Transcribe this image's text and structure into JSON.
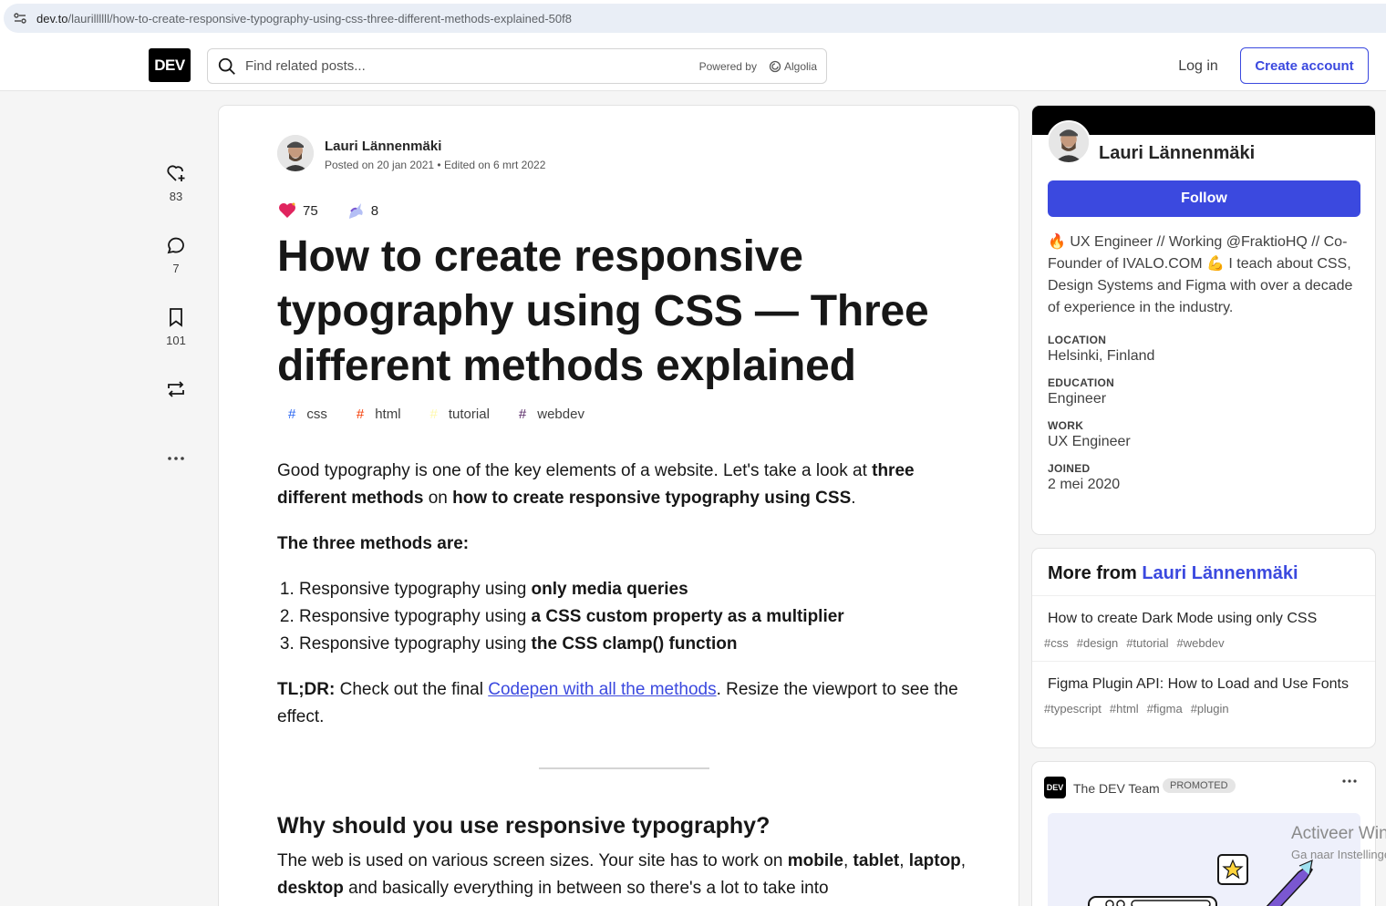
{
  "browser": {
    "url_host": "dev.to",
    "url_path": "/laurillllll/how-to-create-responsive-typography-using-css-three-different-methods-explained-50f8"
  },
  "header": {
    "logo": "DEV",
    "search_placeholder": "Find related posts...",
    "powered_by": "Powered by",
    "algolia": "Algolia",
    "login": "Log in",
    "create_account": "Create account"
  },
  "reactions_sidebar": {
    "likes": "83",
    "comments": "7",
    "bookmarks": "101"
  },
  "article": {
    "author": "Lauri Lännenmäki",
    "posted": "Posted on 20 jan 2021 • Edited on 6 mrt 2022",
    "heart_count": "75",
    "unicorn_count": "8",
    "title": "How to create responsive typography using CSS — Three different methods explained",
    "tags": [
      {
        "hash": "#",
        "name": "css",
        "color": "#2965f1"
      },
      {
        "hash": "#",
        "name": "html",
        "color": "#f53900"
      },
      {
        "hash": "#",
        "name": "tutorial",
        "color": "#fff9ac"
      },
      {
        "hash": "#",
        "name": "webdev",
        "color": "#562765"
      }
    ],
    "intro_1": "Good typography is one of the key elements of a website. Let's take a look at ",
    "intro_b1": "three different methods",
    "intro_2": " on ",
    "intro_b2": "how to create responsive typography using CSS",
    "intro_3": ".",
    "methods_heading": "The three methods are:",
    "methods": [
      {
        "pre": "Responsive typography using ",
        "bold": "only media queries"
      },
      {
        "pre": "Responsive typography using ",
        "bold": "a CSS custom property as a multiplier"
      },
      {
        "pre": "Responsive typography using ",
        "bold": "the CSS clamp() function"
      }
    ],
    "tldr_label": "TL;DR:",
    "tldr_1": " Check out the final ",
    "tldr_link": "Codepen with all the methods",
    "tldr_2": ". Resize the viewport to see the effect.",
    "h2": "Why should you use responsive typography?",
    "p2_1": "The web is used on various screen sizes. Your site has to work on ",
    "p2_b1": "mobile",
    "p2_c1": ", ",
    "p2_b2": "tablet",
    "p2_c2": ", ",
    "p2_b3": "laptop",
    "p2_c3": ", ",
    "p2_b4": "desktop",
    "p2_2": " and basically everything in between so there's a lot to take into"
  },
  "profile": {
    "name": "Lauri Lännenmäki",
    "follow": "Follow",
    "bio": "🔥 UX Engineer // Working @FraktioHQ // Co-Founder of IVALO.COM 💪 I teach about CSS, Design Systems and Figma with over a decade of experience in the industry.",
    "location_label": "LOCATION",
    "location": "Helsinki, Finland",
    "education_label": "EDUCATION",
    "education": "Engineer",
    "work_label": "WORK",
    "work": "UX Engineer",
    "joined_label": "JOINED",
    "joined": "2 mei 2020"
  },
  "more_from": {
    "prefix": "More from ",
    "author": "Lauri Lännenmäki",
    "items": [
      {
        "title": "How to create Dark Mode using only CSS",
        "tags": [
          "#css",
          "#design",
          "#tutorial",
          "#webdev"
        ]
      },
      {
        "title": "Figma Plugin API: How to Load and Use Fonts",
        "tags": [
          "#typescript",
          "#html",
          "#figma",
          "#plugin"
        ]
      }
    ]
  },
  "promo": {
    "logo": "DEV",
    "name": "The DEV Team",
    "badge": "PROMOTED"
  },
  "watermark": {
    "line1": "Activeer Windows",
    "line2": "Ga naar Instellingen"
  },
  "colors": {
    "accent": "#3b49df",
    "background": "#f5f5f5"
  }
}
